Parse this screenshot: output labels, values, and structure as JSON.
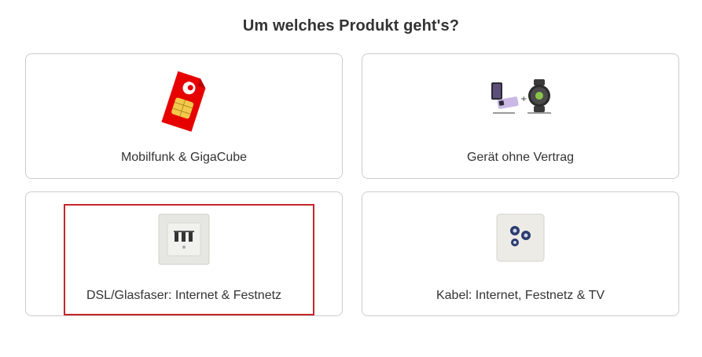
{
  "heading": "Um welches Produkt geht's?",
  "options": [
    {
      "label": "Mobilfunk & GigaCube",
      "icon": "sim-card-icon"
    },
    {
      "label": "Gerät ohne Vertrag",
      "icon": "foldable-phone-and-smartwatch-icon"
    },
    {
      "label": "DSL/Glasfaser: Internet & Festnetz",
      "icon": "phone-socket-icon",
      "selected": true
    },
    {
      "label": "Kabel: Internet, Festnetz & TV",
      "icon": "coax-socket-icon"
    }
  ],
  "colors": {
    "accent": "#c4262b",
    "border": "#cccccc",
    "text": "#333333"
  }
}
